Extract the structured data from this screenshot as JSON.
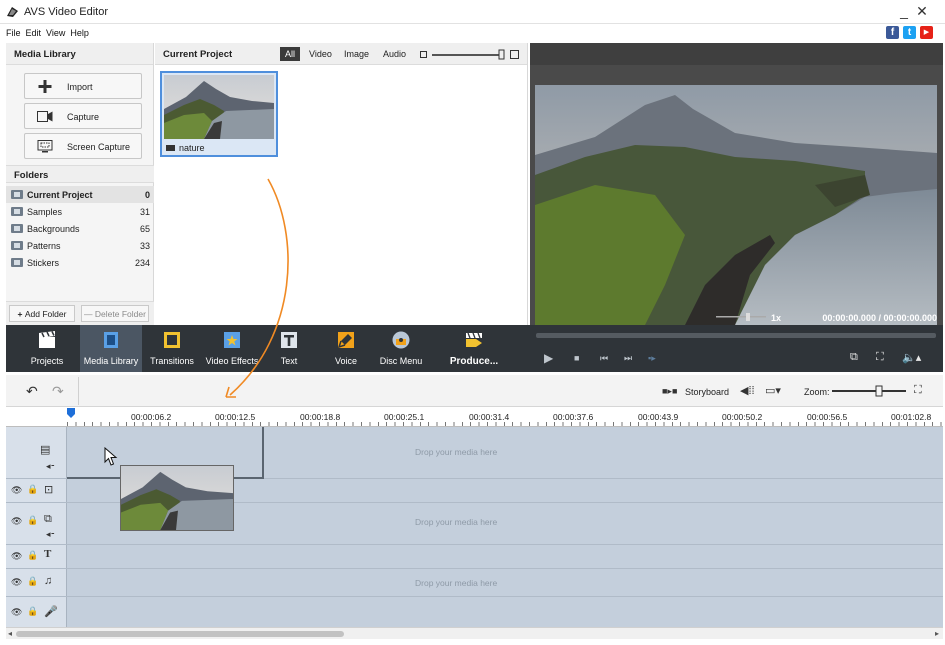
{
  "window": {
    "title": "AVS Video Editor"
  },
  "menu": [
    "File",
    "Edit",
    "View",
    "Help"
  ],
  "social": [
    {
      "name": "facebook-icon",
      "glyph": "f",
      "color": "#3b5998"
    },
    {
      "name": "twitter-icon",
      "glyph": "t",
      "color": "#1da1f2"
    },
    {
      "name": "youtube-icon",
      "glyph": "▶",
      "color": "#e62117"
    }
  ],
  "media_library": {
    "heading": "Media Library",
    "buttons": {
      "import": "Import",
      "capture": "Capture",
      "screen_capture": "Screen Capture"
    },
    "folders_heading": "Folders",
    "folders": [
      {
        "name": "Current Project",
        "count": "0"
      },
      {
        "name": "Samples",
        "count": "31"
      },
      {
        "name": "Backgrounds",
        "count": "65"
      },
      {
        "name": "Patterns",
        "count": "33"
      },
      {
        "name": "Stickers",
        "count": "234"
      }
    ],
    "add_folder": "Add Folder",
    "delete_folder": "Delete Folder"
  },
  "project": {
    "heading": "Current Project",
    "filters": [
      "All",
      "Video",
      "Image",
      "Audio"
    ],
    "active_filter": "All",
    "items": [
      {
        "label": "nature"
      }
    ]
  },
  "preview": {
    "speed": "1x",
    "time": "00:00:00.000 / 00:00:00.000"
  },
  "tools": [
    {
      "label": "Projects"
    },
    {
      "label": "Media Library"
    },
    {
      "label": "Transitions"
    },
    {
      "label": "Video Effects"
    },
    {
      "label": "Text"
    },
    {
      "label": "Voice"
    },
    {
      "label": "Disc Menu"
    },
    {
      "label": "Produce..."
    }
  ],
  "timeline": {
    "storyboard_label": "Storyboard",
    "zoom_label": "Zoom:",
    "ticks": [
      "00:00:06.2",
      "00:00:12.5",
      "00:00:18.8",
      "00:00:25.1",
      "00:00:31.4",
      "00:00:37.6",
      "00:00:43.9",
      "00:00:50.2",
      "00:00:56.5",
      "00:01:02.8"
    ],
    "drop_text": "Drop your media here"
  },
  "colors": {
    "accent": "#4f8fdc",
    "toolbar_bg": "#2f3439",
    "timeline_bg": "#c4cfdc"
  }
}
